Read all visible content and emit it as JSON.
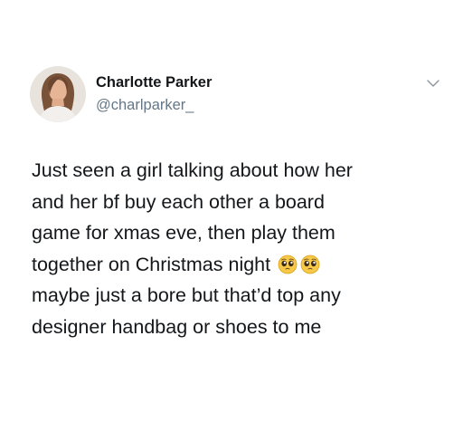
{
  "tweet": {
    "display_name": "Charlotte Parker",
    "handle": "@charlparker_",
    "body_lines": [
      "Just seen a girl talking about how her",
      "and her bf buy each other a board",
      "game for xmas eve, then play them",
      "together on Christmas night",
      "maybe just a bore but that’d top any",
      "designer handbag or shoes to me"
    ],
    "emojis": [
      "pleading-face-emoji",
      "pleading-face-emoji"
    ]
  },
  "icons": {
    "menu": "chevron-down-icon",
    "avatar": "profile-photo"
  },
  "colors": {
    "text": "#14171a",
    "secondary": "#657786",
    "background": "#ffffff"
  }
}
